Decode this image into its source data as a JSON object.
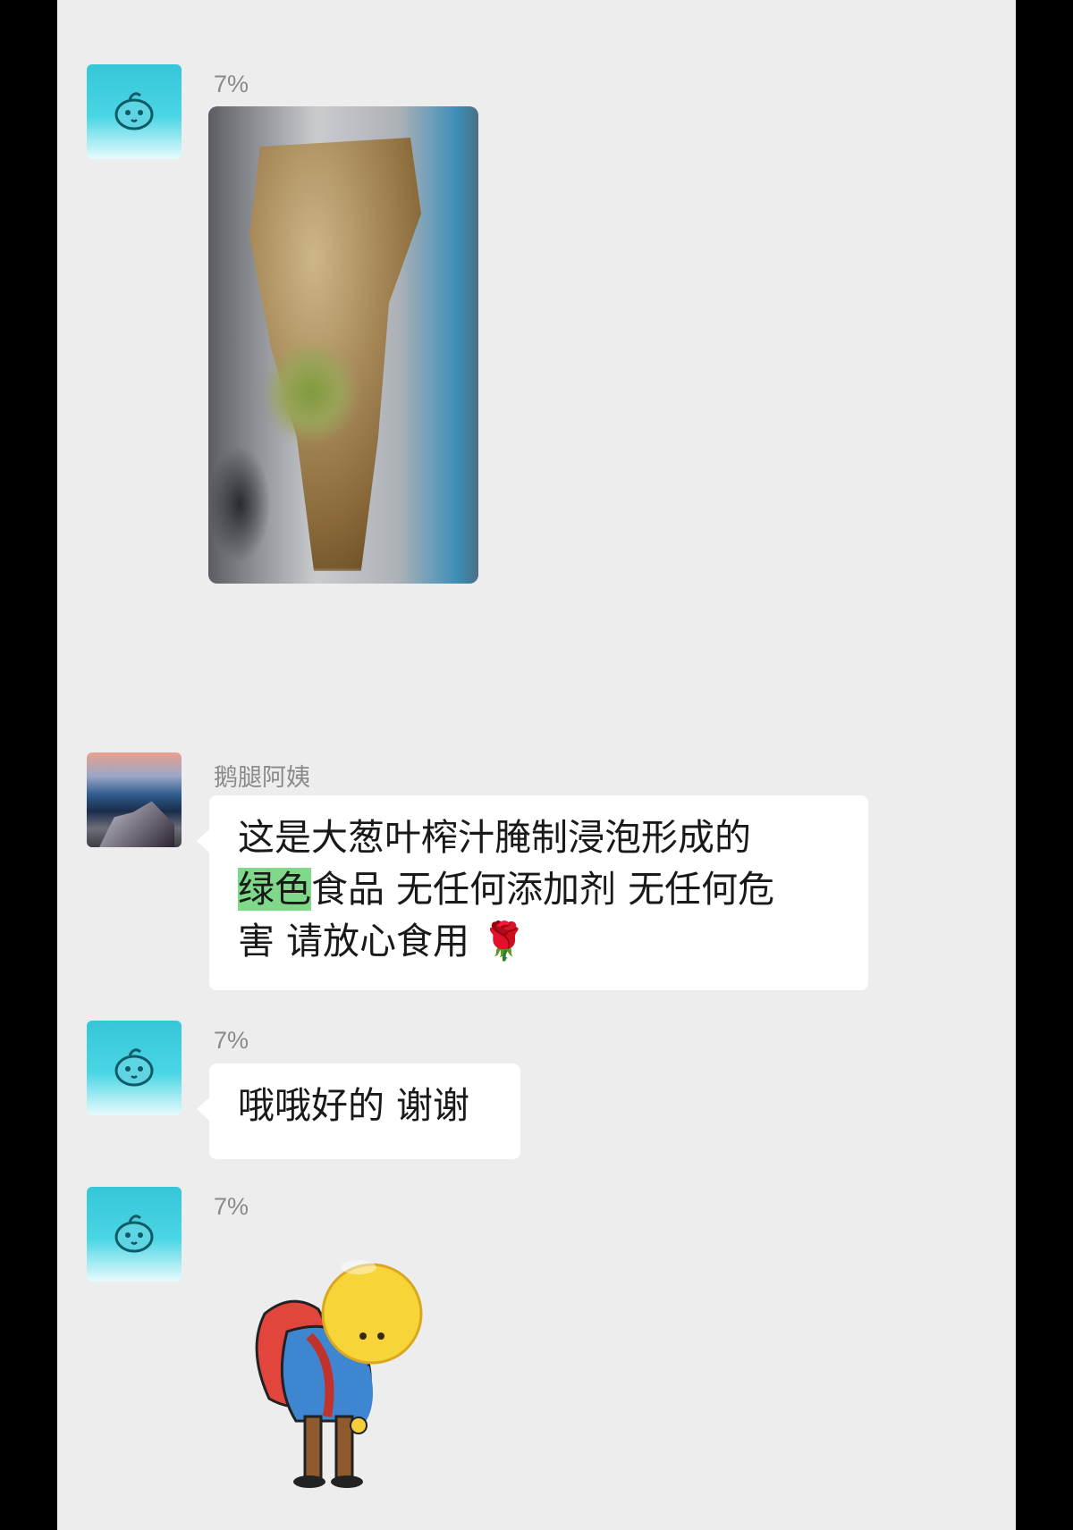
{
  "chat": {
    "messages": [
      {
        "sender": "7%",
        "avatar": "cyan-bird-avatar",
        "type": "image",
        "image_desc": "photo"
      },
      {
        "sender": "鹅腿阿姨",
        "avatar": "landscape-photo-avatar",
        "type": "text",
        "text_part1": "这是大葱叶榨汁腌制浸泡形成的",
        "text_highlight": "绿色",
        "text_part2": "食品 无任何添加剂 无任何危",
        "text_part3": "害 请放心食用 ",
        "emoji": "🌹"
      },
      {
        "sender": "7%",
        "avatar": "cyan-bird-avatar",
        "type": "text",
        "text": "哦哦好的 谢谢"
      },
      {
        "sender": "7%",
        "avatar": "cyan-bird-avatar",
        "type": "sticker",
        "sticker": "bowing-emoji-sticker"
      }
    ]
  },
  "colors": {
    "background": "#ededed",
    "bubble": "#ffffff",
    "highlight": "#80d88b",
    "sender_name": "#8a8a8a"
  }
}
